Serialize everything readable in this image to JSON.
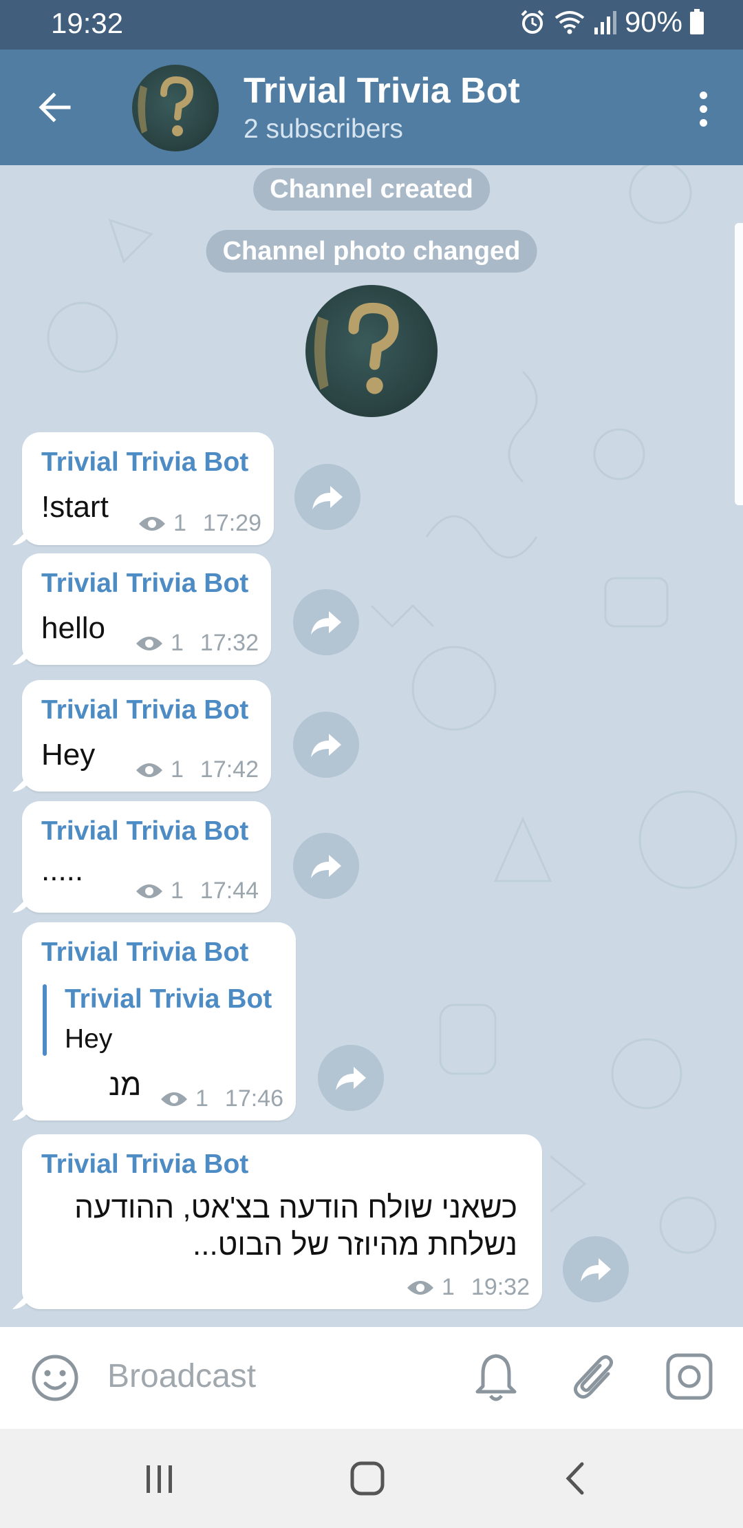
{
  "status_bar": {
    "time": "19:32",
    "battery": "90%"
  },
  "header": {
    "title": "Trivial Trivia Bot",
    "subtitle": "2 subscribers"
  },
  "service_messages": {
    "created": "Channel created",
    "photo_changed": "Channel photo changed"
  },
  "messages": [
    {
      "sender": "Trivial Trivia Bot",
      "text": "!start",
      "views": "1",
      "time": "17:29"
    },
    {
      "sender": "Trivial Trivia Bot",
      "text": "hello",
      "views": "1",
      "time": "17:32"
    },
    {
      "sender": "Trivial Trivia Bot",
      "text": "Hey",
      "views": "1",
      "time": "17:42"
    },
    {
      "sender": "Trivial Trivia Bot",
      "text": ".....",
      "views": "1",
      "time": "17:44"
    },
    {
      "sender": "Trivial Trivia Bot",
      "reply_to_sender": "Trivial Trivia Bot",
      "reply_to_text": "Hey",
      "text": "מנ",
      "views": "1",
      "time": "17:46"
    },
    {
      "sender": "Trivial Trivia Bot",
      "text_line1": "כשאני שולח הודעה בצ'אט, ההודעה",
      "text_line2": "נשלחת מהיוזר של הבוט...",
      "views": "1",
      "time": "19:32"
    }
  ],
  "input": {
    "placeholder": "Broadcast"
  },
  "icons": {
    "back": "arrow-left-icon",
    "menu": "more-vert-icon",
    "share": "share-icon",
    "views": "eye-icon",
    "emoji": "smiley-icon",
    "bell": "bell-icon",
    "attach": "paperclip-icon",
    "camera": "instagram-camera-icon"
  },
  "colors": {
    "header": "#517da2",
    "status_bar": "#415e7c",
    "accent": "#4d8bc4",
    "chat_bg": "#ccd9e4"
  }
}
